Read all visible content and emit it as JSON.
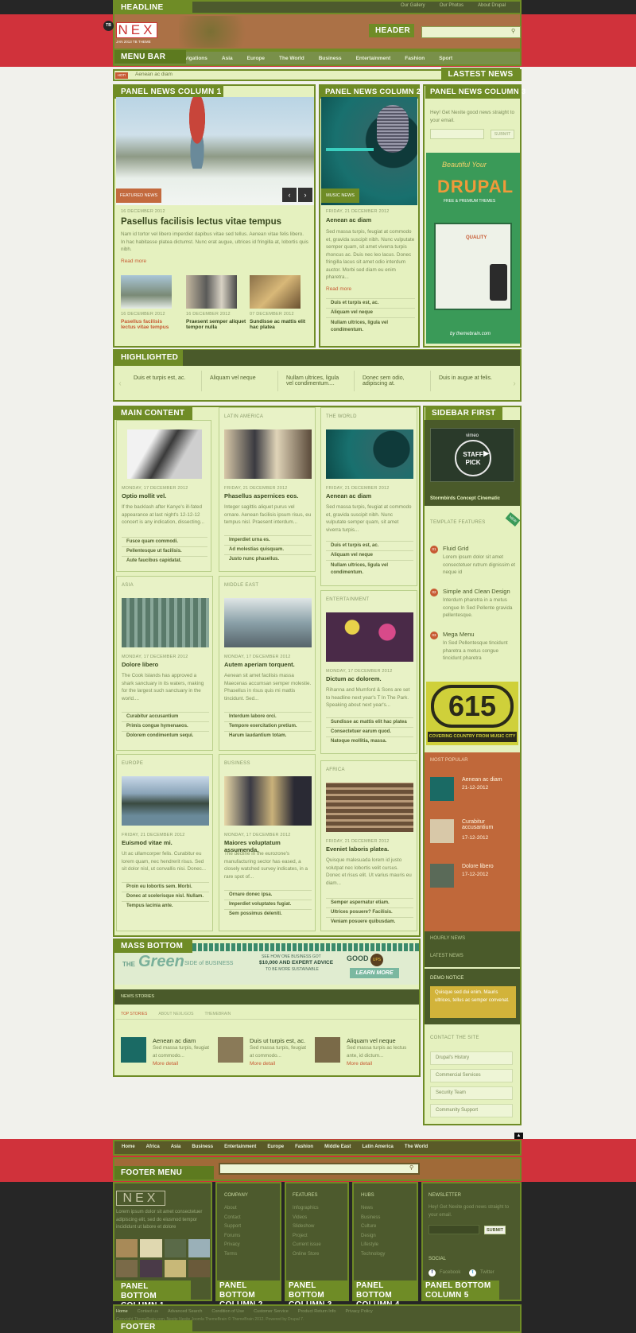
{
  "labels": {
    "headline": "HEADLINE",
    "header": "HEADER",
    "menu_bar": "MENU BAR",
    "latest_news": "LASTEST NEWS",
    "panel_news_1": "PANEL NEWS COLUMN 1",
    "panel_news_2": "PANEL NEWS COLUMN 2",
    "panel_news_3": "PANEL NEWS COLUMN 3",
    "highlighted": "HIGHLIGHTED",
    "main_content": "MAIN CONTENT",
    "sidebar_first": "SIDEBAR FIRST",
    "mass_bottom": "MASS BOTTOM",
    "footer_menu": "FOOTER MENU",
    "panel_bottom_1": "PANEL BOTTOM COLUMN 1",
    "panel_bottom_2": "PANEL BOTTOM COLUMN 2",
    "panel_bottom_3": "PANEL BOTTOM COLUMN 3",
    "panel_bottom_4": "PANEL BOTTOM COLUMN 4",
    "panel_bottom_5": "PANEL BOTTOM COLUMN 5",
    "footer": "FOOTER"
  },
  "top_links": [
    "Our Gallery",
    "Our Photos",
    "About Drupal"
  ],
  "logo": {
    "badge": "TB",
    "text": "NEX",
    "tagline": "JAN 2013 TB THEME"
  },
  "nav": [
    "Home",
    "Links",
    "Navigations",
    "Asia",
    "Europe",
    "The World",
    "Business",
    "Entertainment",
    "Fashion",
    "Sport"
  ],
  "ticker": {
    "hot": "HOT!",
    "text": "Aenean ac diam"
  },
  "panel1": {
    "tag": "FEATURED NEWS",
    "date": "16 DECEMBER 2012",
    "title": "Pasellus facilisis lectus vitae tempus",
    "body": "Nam id tortor vel libero imperdiet dapibus vitae sed tellus. Aenean vitae felis libero. In hac habitasse platea dictumst. Nunc erat augue, ultrices id fringilla at, lobortis quis nibh.",
    "more": "Read more",
    "minis": [
      {
        "date": "16 DECEMBER 2012",
        "title": "Pasellus facilisis lectus vitae tempus"
      },
      {
        "date": "16 DECEMBER 2012",
        "title": "Praesent semper aliquet tempor nulla"
      },
      {
        "date": "07 DECEMBER 2012",
        "title": "Sundisse ac mattis elit hac platea"
      }
    ]
  },
  "panel2": {
    "tag": "MUSIC NEWS",
    "date": "FRIDAY, 21 DECEMBER 2012",
    "title": "Aenean ac diam",
    "body": "Sed massa turpis, feugiat at commodo et, gravida suscipit nibh. Nunc vulputate semper quam, sit amet viverra turpis rhoncus ac. Duis nec leo lacus. Donec fringilla lacus sit amet odio interdum auctor. Morbi sed diam eu enim pharetra...",
    "more": "Read more",
    "bullets": [
      "Duis et turpis est, ac.",
      "Aliquam vel neque",
      "Nullam ultrices, ligula vel condimentum."
    ]
  },
  "panel3": {
    "text": "Hey! Get Nexite good news straight to your email.",
    "submit": "SUBMIT",
    "ad_title": "Beautiful Your",
    "ad_brand": "DRUPAL",
    "ad_sub": "FREE & PREMIUM THEMES",
    "ad_quality": "QUALITY",
    "ad_by": "by themebrain.com"
  },
  "highlighted": [
    "Duis et turpis est, ac.",
    "Aliquam vel neque",
    "Nullam ultrices, ligula vel condimentum....",
    "Donec sem odio, adipiscing at.",
    "Duis in augue at felis."
  ],
  "main": [
    {
      "section": "",
      "date": "MONDAY, 17 DECEMBER 2012",
      "title": "Optio mollit vel.",
      "body": "If the backlash after Kanye's ill-fated appearance at last night's 12-12-12 concert is any indication, dissecting...",
      "bullets": [
        "Fusce quam commodi.",
        "Pellentesque ut facilisis.",
        "Aute faucibus capidatat."
      ]
    },
    {
      "section": "LATIN AMERICA",
      "date": "FRIDAY, 21 DECEMBER 2012",
      "title": "Phasellus aspernices eos.",
      "body": "Integer sagittis aliquet purus vel ornare. Aenean facilisis ipsum risus, eu tempus nisl. Praesent interdum...",
      "bullets": [
        "Imperdiet urna es.",
        "Ad molestias quisquam.",
        "Justo nunc phasellus."
      ]
    },
    {
      "section": "THE WORLD",
      "date": "FRIDAY, 21 DECEMBER 2012",
      "title": "Aenean ac diam",
      "body": "Sed massa turpis, feugiat at commodo et, gravida suscipit nibh. Nunc vulputate semper quam, sit amet viverra turpis...",
      "bullets": [
        "Duis et turpis est, ac.",
        "Aliquam vel neque",
        "Nullam ultrices, ligula vel condimentum."
      ]
    },
    {
      "section": "ASIA",
      "date": "MONDAY, 17 DECEMBER 2012",
      "title": "Dolore libero",
      "body": "The Cook Islands has approved a shark sanctuary in its waters, making for the largest such sanctuary in the world....",
      "bullets": [
        "Curabitur accusantium",
        "Primis congue hymenaeos.",
        "Dolorem condimentum sequi."
      ]
    },
    {
      "section": "MIDDLE EAST",
      "date": "MONDAY, 17 DECEMBER 2012",
      "title": "Autem aperiam torquent.",
      "body": "Aenean sit amet facilisis massa Maecenas accumsan semper molestie. Phasellus in risus quis mi mattis tincidunt. Sed...",
      "bullets": [
        "Interdum labore orci.",
        "Tempore exercitation pretium.",
        "Harum laudantium totam."
      ]
    },
    {
      "section": "ENTERTAINMENT",
      "date": "MONDAY, 17 DECEMBER 2012",
      "title": "Dictum ac dolorem.",
      "body": "Rihanna and Mumford & Sons are set to headline next year's T In The Park. Speaking about next year's...",
      "bullets": [
        "Sundisse ac mattis elit hac platea",
        "Consectetuer earum quod.",
        "Natoque mollitia, massa."
      ]
    },
    {
      "section": "EUROPE",
      "date": "FRIDAY, 21 DECEMBER 2012",
      "title": "Euismod vitae mi.",
      "body": "Ut ac ullamcorper felis. Curabitur eu lorem quam, nec hendrerit risus. Sed sit dolor nisl, ut convallis nisi. Donec...",
      "bullets": [
        "Proin eu lobortis sem. Morbi.",
        "Donec at scelerisque nisl. Nullam.",
        "Tempus lacinia ante."
      ]
    },
    {
      "section": "BUSINESS",
      "date": "MONDAY, 17 DECEMBER 2012",
      "title": "Maiores voluptatum assumenda.",
      "body": "The decline in the eurozone's manufacturing sector has eased, a closely watched survey indicates, in a rare spot of...",
      "bullets": [
        "Ornare donec ipsa.",
        "Imperdiet voluptates fugiat.",
        "Sem possimus deleniti."
      ]
    },
    {
      "section": "AFRICA",
      "date": "FRIDAY, 21 DECEMBER 2012",
      "title": "Eveniet laboris platea.",
      "body": "Quisque malesuada lorem id justo volutpat nec lobortis velit cursus. Donec et risus elit. Ut varius mauris eu diam...",
      "bullets": [
        "Semper aspernatur etiam.",
        "Ultrices posuere? Facilisis.",
        "Veniam posuere quibusdam."
      ]
    }
  ],
  "sidebar": {
    "video_title": "Stormbirds Concept Cinematic",
    "vimeo": "vimeo",
    "staff": "STAFF PICK",
    "features_title": "TEMPLATE FEATURES",
    "new_badge": "NEW",
    "features": [
      {
        "num": "01",
        "title": "Fluid Grid",
        "body": "Lorem ipsum dolor sit amet consectetuer rutrum dignissim et neque id"
      },
      {
        "num": "02",
        "title": "Simple and Clean Design",
        "body": "Interdum pharetra in a metus congue In Sed Pellente gravida pellentesque."
      },
      {
        "num": "03",
        "title": "Mega Menu",
        "body": "In Sed Pellentesque tincidunt pharetra a metus congue tincidunt pharetra"
      }
    ],
    "ad_big": "615",
    "ad_sub": "COVERING COUNTRY FROM MUSIC CITY",
    "popular_title": "MOST POPULAR",
    "popular": [
      {
        "title": "Aenean ac diam",
        "date": "21-12-2012"
      },
      {
        "title": "Curabitur accusantium",
        "date": "17-12-2012"
      },
      {
        "title": "Dolore libero",
        "date": "17-12-2012"
      }
    ],
    "hourly": "HOURLY NEWS",
    "latest": "LATEST NEWS",
    "demo_title": "DEMO NOTICE",
    "demo_text": "Quisque sed dui enim. Mauris ultrices, tellus ac semper convenat.",
    "contact_title": "CONTACT THE SITE",
    "contact": [
      "Drupal's History",
      "Commercial Services",
      "Security Team",
      "Community Support"
    ]
  },
  "mass": {
    "green": "Green",
    "the": "THE",
    "side": "SIDE of BUSINESS",
    "offer1": "SEE HOW ONE BUSINESS GOT",
    "offer2": "$10,000 AND EXPERT ADVICE",
    "offer3": "TO BE MORE SUSTAINABLE",
    "learn": "LEARN MORE",
    "good": "GOOD",
    "ups": "UPS",
    "news_title": "NEWS STORIES",
    "tabs": [
      "TOP STORIES",
      "ABOUT NEXLIGOS",
      "THEMEBRAIN"
    ],
    "items": [
      {
        "title": "Aenean ac diam",
        "body": "Sed massa turpis, feugiat at commodo...",
        "more": "More detail"
      },
      {
        "title": "Duis ut turpis est, ac.",
        "body": "Sed massa turpis, feugiat at commodo...",
        "more": "More detail"
      },
      {
        "title": "Aliquam vel neque",
        "body": "Sed massa turpis ac lectus ante, id dictum...",
        "more": "More detail"
      }
    ]
  },
  "footer_nav": [
    "Home",
    "Africa",
    "Asia",
    "Business",
    "Entertainment",
    "Europe",
    "Fashion",
    "Middle East",
    "Latin America",
    "The World"
  ],
  "bottom": {
    "about": "Lorem ipsum dolor sit amet consectetuer adipiscing elit, sed do eiusmod tempor incididunt ut labore et dolore",
    "company_title": "COMPANY",
    "company": [
      "About",
      "Contact",
      "Support",
      "Forums",
      "Privacy",
      "Terms"
    ],
    "features_title": "FEATURES",
    "features": [
      "Infographics",
      "Videos",
      "Slideshow",
      "Project",
      "Current issue",
      "Online Store"
    ],
    "hubs_title": "HUBS",
    "hubs": [
      "News",
      "Business",
      "Culture",
      "Design",
      "Lifestyle",
      "Technology"
    ],
    "newsletter_title": "NEWSLETTER",
    "newsletter_text": "Hey! Get Nexite good news straight to your email.",
    "submit": "SUBMIT",
    "social_title": "SOCIAL",
    "facebook": "Facebook",
    "twitter": "Twitter"
  },
  "footer": {
    "links": [
      "Home",
      "Contact us",
      "Advanced Search",
      "Condition of Use",
      "Customer Service",
      "Product Return Info",
      "Privacy Policy"
    ],
    "copy": "Copyright ThemeBrain.com. Nexite Nexite Joomla ThemeBrain © ThemeBrain 2012. Powered by Drupal 7."
  }
}
